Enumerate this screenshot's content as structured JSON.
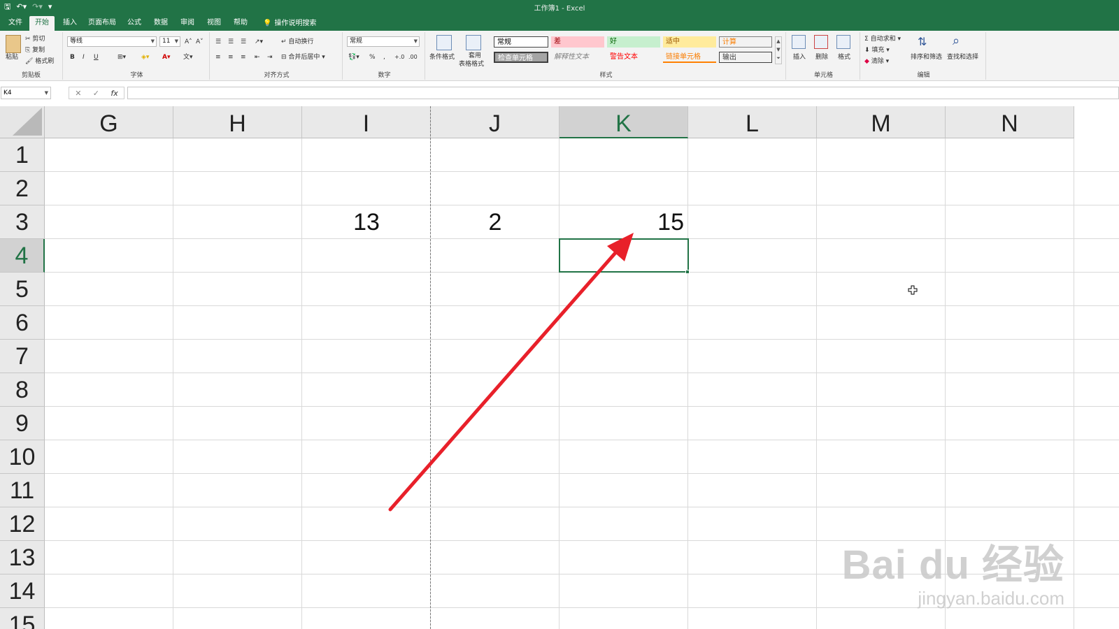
{
  "window": {
    "title": "工作簿1  -  Excel"
  },
  "quick_access": {
    "save_icon": "save-icon",
    "undo_icon": "undo-icon",
    "redo_icon": "redo-icon",
    "customize_icon": "customize-qat-icon"
  },
  "tabs": [
    {
      "label": "文件"
    },
    {
      "label": "开始"
    },
    {
      "label": "插入"
    },
    {
      "label": "页面布局"
    },
    {
      "label": "公式"
    },
    {
      "label": "数据"
    },
    {
      "label": "审阅"
    },
    {
      "label": "视图"
    },
    {
      "label": "帮助"
    },
    {
      "label": "操作说明搜索"
    }
  ],
  "ribbon": {
    "clipboard": {
      "paste": "粘贴",
      "cut": "剪切",
      "copy": "复制",
      "format_painter": "格式刷",
      "group_label": "剪贴板"
    },
    "font": {
      "font_name": "等线",
      "font_size": "11",
      "bold": "B",
      "italic": "I",
      "underline": "U",
      "group_label": "字体"
    },
    "alignment": {
      "wrap_text": "自动换行",
      "merge_center": "合并后居中",
      "group_label": "对齐方式"
    },
    "number": {
      "format": "常规",
      "percent": "%",
      "comma": ",",
      "inc_decimal": "+.0",
      "dec_decimal": ".00",
      "group_label": "数字"
    },
    "styles": {
      "conditional_format": "条件格式",
      "table_format_line1": "套用",
      "table_format_line2": "表格格式",
      "cells": [
        {
          "label": "常规",
          "bg": "#ffffff",
          "color": "#000000"
        },
        {
          "label": "差",
          "bg": "#ffc7ce",
          "color": "#9c0006"
        },
        {
          "label": "好",
          "bg": "#c6efce",
          "color": "#006100"
        },
        {
          "label": "适中",
          "bg": "#ffeb9c",
          "color": "#9c5700"
        },
        {
          "label": "计算",
          "bg": "#f2f2f2",
          "color": "#fa7d00"
        },
        {
          "label": "检查单元格",
          "bg": "#a5a5a5",
          "color": "#ffffff"
        },
        {
          "label": "解释性文本",
          "bg": "#f3f3f3",
          "color": "#7f7f7f"
        },
        {
          "label": "警告文本",
          "bg": "#f3f3f3",
          "color": "#ff0000"
        },
        {
          "label": "链接单元格",
          "bg": "#f3f3f3",
          "color": "#fa7d00"
        },
        {
          "label": "输出",
          "bg": "#f2f2f2",
          "color": "#3f3f3f"
        }
      ],
      "group_label": "样式"
    },
    "cells": {
      "insert": "插入",
      "delete": "删除",
      "format": "格式",
      "group_label": "单元格"
    },
    "editing": {
      "autosum": "自动求和",
      "fill": "填充",
      "clear": "清除",
      "sort_filter": "排序和筛选",
      "find_select": "查找和选择",
      "group_label": "编辑"
    }
  },
  "formula_bar": {
    "name_box": "K4",
    "cancel": "✕",
    "enter": "✓",
    "fx": "fx",
    "content": ""
  },
  "sheet": {
    "columns": [
      "G",
      "H",
      "I",
      "J",
      "K",
      "L",
      "M",
      "N"
    ],
    "rows": [
      "1",
      "2",
      "3",
      "4",
      "5",
      "6",
      "7",
      "8",
      "9",
      "10",
      "11",
      "12",
      "13",
      "14",
      "15"
    ],
    "selected_column": "K",
    "selected_row": "4",
    "cells": {
      "I3": "13",
      "J3": "2",
      "K3": "15"
    }
  },
  "annotation": {
    "arrow_color": "#e8202a"
  },
  "watermark": {
    "main": "Bai du 经验",
    "sub": "jingyan.baidu.com"
  }
}
